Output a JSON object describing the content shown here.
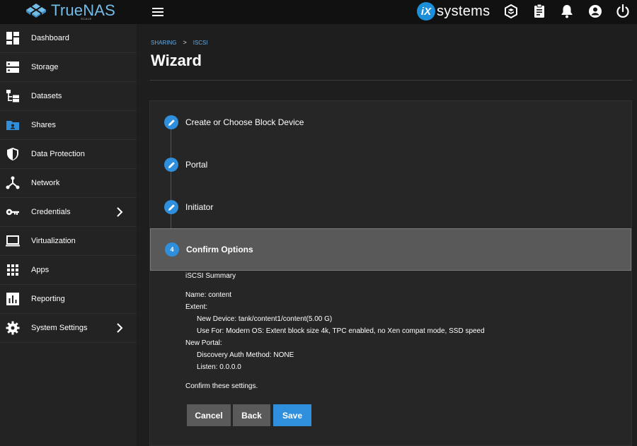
{
  "brand": {
    "name": "TrueNAS",
    "edition": "SCALE"
  },
  "vendor": {
    "mark": "iX",
    "name": "systems"
  },
  "topbar": {
    "icons": [
      "truecommand-icon",
      "task-manager-icon",
      "notifications-icon",
      "account-icon",
      "power-icon"
    ]
  },
  "sidebar": {
    "items": [
      {
        "label": "Dashboard",
        "icon": "dashboard-icon"
      },
      {
        "label": "Storage",
        "icon": "storage-icon"
      },
      {
        "label": "Datasets",
        "icon": "datasets-icon"
      },
      {
        "label": "Shares",
        "icon": "shares-icon",
        "active": true
      },
      {
        "label": "Data Protection",
        "icon": "shield-icon"
      },
      {
        "label": "Network",
        "icon": "network-icon"
      },
      {
        "label": "Credentials",
        "icon": "key-icon",
        "expandable": true
      },
      {
        "label": "Virtualization",
        "icon": "laptop-icon"
      },
      {
        "label": "Apps",
        "icon": "apps-grid-icon"
      },
      {
        "label": "Reporting",
        "icon": "reporting-icon"
      },
      {
        "label": "System Settings",
        "icon": "gear-icon",
        "expandable": true
      }
    ]
  },
  "breadcrumb": {
    "items": [
      "SHARING",
      "ISCSI"
    ],
    "separator": ">"
  },
  "page": {
    "title": "Wizard"
  },
  "wizard": {
    "steps": [
      {
        "label": "Create or Choose Block Device",
        "state": "edit"
      },
      {
        "label": "Portal",
        "state": "edit"
      },
      {
        "label": "Initiator",
        "state": "edit"
      },
      {
        "label": "Confirm Options",
        "state": "active",
        "number": "4"
      }
    ],
    "summary": {
      "heading": "iSCSI Summary",
      "name": "Name: content",
      "extent": "Extent:",
      "new_device": "New Device: tank/content1/content(5.00 G)",
      "use_for": "Use For: Modern OS: Extent block size 4k, TPC enabled, no Xen compat mode, SSD speed",
      "new_portal": "New Portal:",
      "discovery_auth": "Discovery Auth Method: NONE",
      "listen": "Listen: 0.0.0.0",
      "confirm": "Confirm these settings."
    },
    "buttons": {
      "cancel": "Cancel",
      "back": "Back",
      "save": "Save"
    }
  },
  "colors": {
    "accent": "#2f8fdc",
    "brand": "#71bde8",
    "cancel_bg": "#5a5a5a",
    "back_bg": "#5a5a5a",
    "active_step_bg": "#595959"
  }
}
